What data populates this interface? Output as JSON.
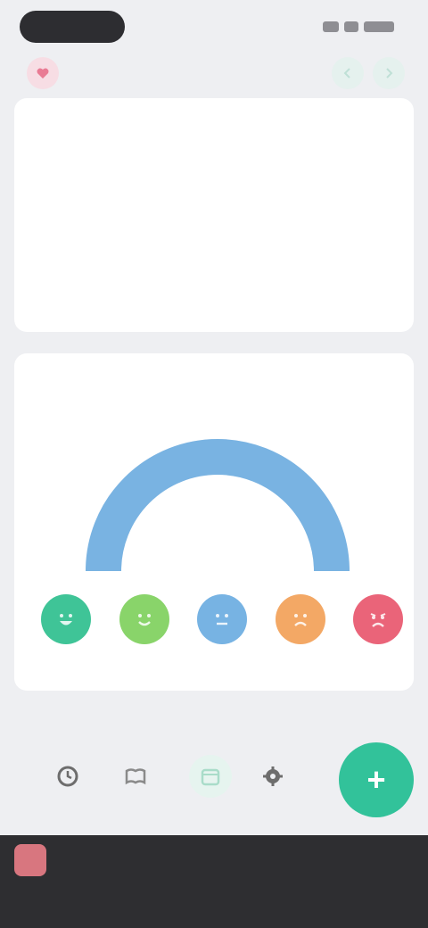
{
  "status": {
    "pill": "",
    "right": ""
  },
  "header": {
    "title": ""
  },
  "calendar": {
    "weekdays": [
      "",
      "",
      "",
      "",
      "",
      "",
      ""
    ],
    "weeks": [
      [
        "",
        "",
        "",
        "",
        "",
        "",
        ""
      ],
      [
        "",
        "",
        "",
        "",
        "",
        "",
        ""
      ],
      [
        "",
        "",
        "",
        "",
        "",
        "",
        ""
      ]
    ]
  },
  "mood_card": {
    "title": "",
    "gauge_value": "",
    "gauge_fraction": 1.0,
    "gauge_color": "#79b3e2",
    "moods": [
      {
        "label": "",
        "color": "#3fc497"
      },
      {
        "label": "",
        "color": "#89d46a"
      },
      {
        "label": "",
        "color": "#77b3e3"
      },
      {
        "label": "",
        "color": "#f3a865"
      },
      {
        "label": "",
        "color": "#ea6479"
      }
    ]
  },
  "tabbar": {
    "tabs": [
      {
        "icon": "clock-icon",
        "color": "#6d6d6d"
      },
      {
        "icon": "book-icon",
        "color": "#8a8a8a"
      },
      {
        "icon": "calendar-icon",
        "color": "#a9dcc9"
      },
      {
        "icon": "gear-icon",
        "color": "#6d6d6d"
      }
    ],
    "add_label": "+",
    "accent": "#32c29a"
  },
  "banner": {
    "title": "",
    "subtitle": "",
    "action": ""
  }
}
